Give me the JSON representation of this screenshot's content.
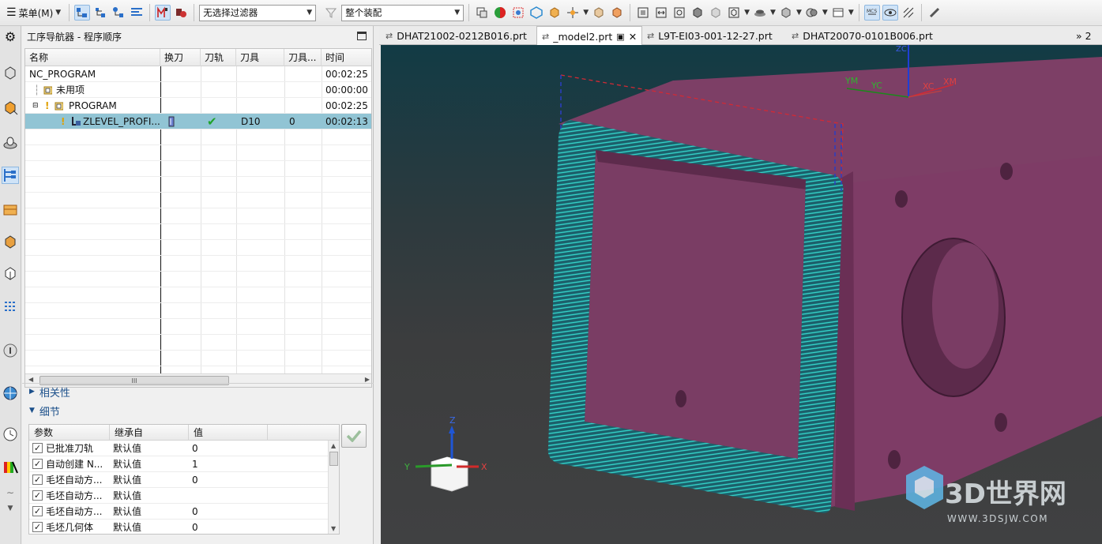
{
  "toolbar": {
    "menu_label": "菜单(M)",
    "filter_value": "无选择过滤器",
    "assembly_value": "整个装配"
  },
  "navigator": {
    "title": "工序导航器 - 程序顺序",
    "columns": [
      "名称",
      "换刀",
      "刀轨",
      "刀具",
      "刀具...",
      "时间"
    ],
    "rows": [
      {
        "name": "NC_PROGRAM",
        "change_tool": "",
        "path": "",
        "tool": "",
        "tool_num": "",
        "time": "00:02:25"
      },
      {
        "name": "未用项",
        "change_tool": "",
        "path": "",
        "tool": "",
        "tool_num": "",
        "time": "00:00:00"
      },
      {
        "name": "PROGRAM",
        "change_tool": "",
        "path": "",
        "tool": "",
        "tool_num": "",
        "time": "00:02:25"
      },
      {
        "name": "ZLEVEL_PROFI...",
        "change_tool": "",
        "path": "✔",
        "tool": "D10",
        "tool_num": "0",
        "time": "00:02:13"
      }
    ],
    "scroll_label": "III"
  },
  "sections": {
    "dependencies": "相关性",
    "details": "细节"
  },
  "details": {
    "columns": [
      "参数",
      "继承自",
      "值"
    ],
    "rows": [
      {
        "param": "已批准刀轨",
        "inherit": "默认值",
        "value": "0"
      },
      {
        "param": "自动创建 N...",
        "inherit": "默认值",
        "value": "1"
      },
      {
        "param": "毛坯自动方...",
        "inherit": "默认值",
        "value": "0"
      },
      {
        "param": "毛坯自动方...",
        "inherit": "默认值",
        "value": ""
      },
      {
        "param": "毛坯自动方...",
        "inherit": "默认值",
        "value": "0"
      },
      {
        "param": "毛坯几何体",
        "inherit": "默认值",
        "value": "0"
      }
    ]
  },
  "tabs": [
    {
      "label": "DHAT21002-0212B016.prt",
      "active": false
    },
    {
      "label": "_model2.prt",
      "active": true
    },
    {
      "label": "L9T-EI03-001-12-27.prt",
      "active": false
    },
    {
      "label": "DHAT20070-0101B006.prt",
      "active": false
    }
  ],
  "tab_overflow": "» 2",
  "triad": {
    "x": "X",
    "y": "Y",
    "z": "Z"
  },
  "wcs": {
    "ym": "YM",
    "yc": "YC",
    "xc": "XC",
    "xm": "XM",
    "zc": "ZC"
  },
  "watermark": {
    "brand": "3D世界网",
    "url": "WWW.3DSJW.COM"
  },
  "colors": {
    "part": "#7b3d63",
    "toolpath": "#2ed3c9",
    "selection": "#91c4d4",
    "accent": "#1b4f8a"
  }
}
